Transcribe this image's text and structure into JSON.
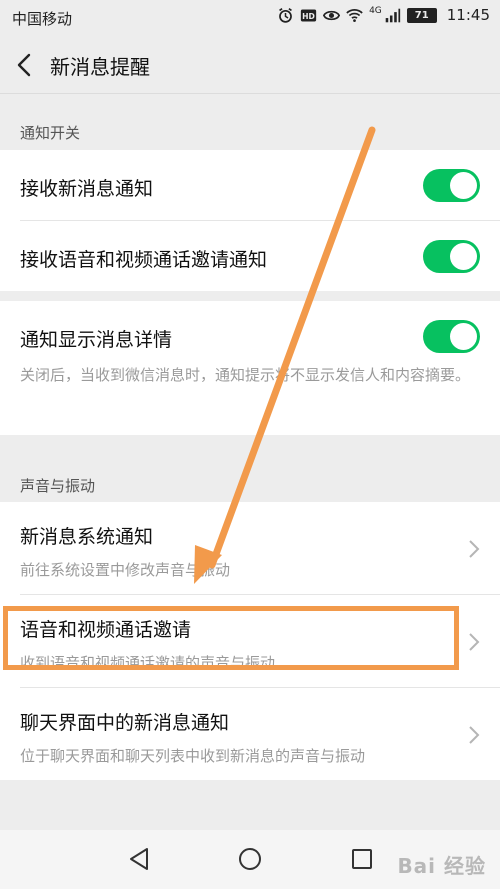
{
  "status_bar": {
    "carrier": "中国移动",
    "network": "4G",
    "battery": "71",
    "time": "11:45"
  },
  "header": {
    "title": "新消息提醒",
    "back_icon": "chevron-left-icon"
  },
  "sections": {
    "notification": {
      "title": "通知开关",
      "items": [
        {
          "label": "接收新消息通知",
          "toggle_on": true
        },
        {
          "label": "接收语音和视频通话邀请通知",
          "toggle_on": true
        },
        {
          "label": "通知显示消息详情",
          "toggle_on": true,
          "description": "关闭后，当收到微信消息时，通知提示将不显示发信人和内容摘要。"
        }
      ]
    },
    "sound": {
      "title": "声音与振动",
      "items": [
        {
          "label": "新消息系统通知",
          "description": "前往系统设置中修改声音与振动"
        },
        {
          "label": "语音和视频通话邀请",
          "description": "收到语音和视频通话邀请的声音与振动"
        },
        {
          "label": "聊天界面中的新消息通知",
          "description": "位于聊天界面和聊天列表中收到新消息的声音与振动"
        }
      ]
    }
  },
  "colors": {
    "toggle_on": "#07c160",
    "annotation": "#f29a4b",
    "background": "#ededed"
  },
  "watermark": "Bai 经验"
}
